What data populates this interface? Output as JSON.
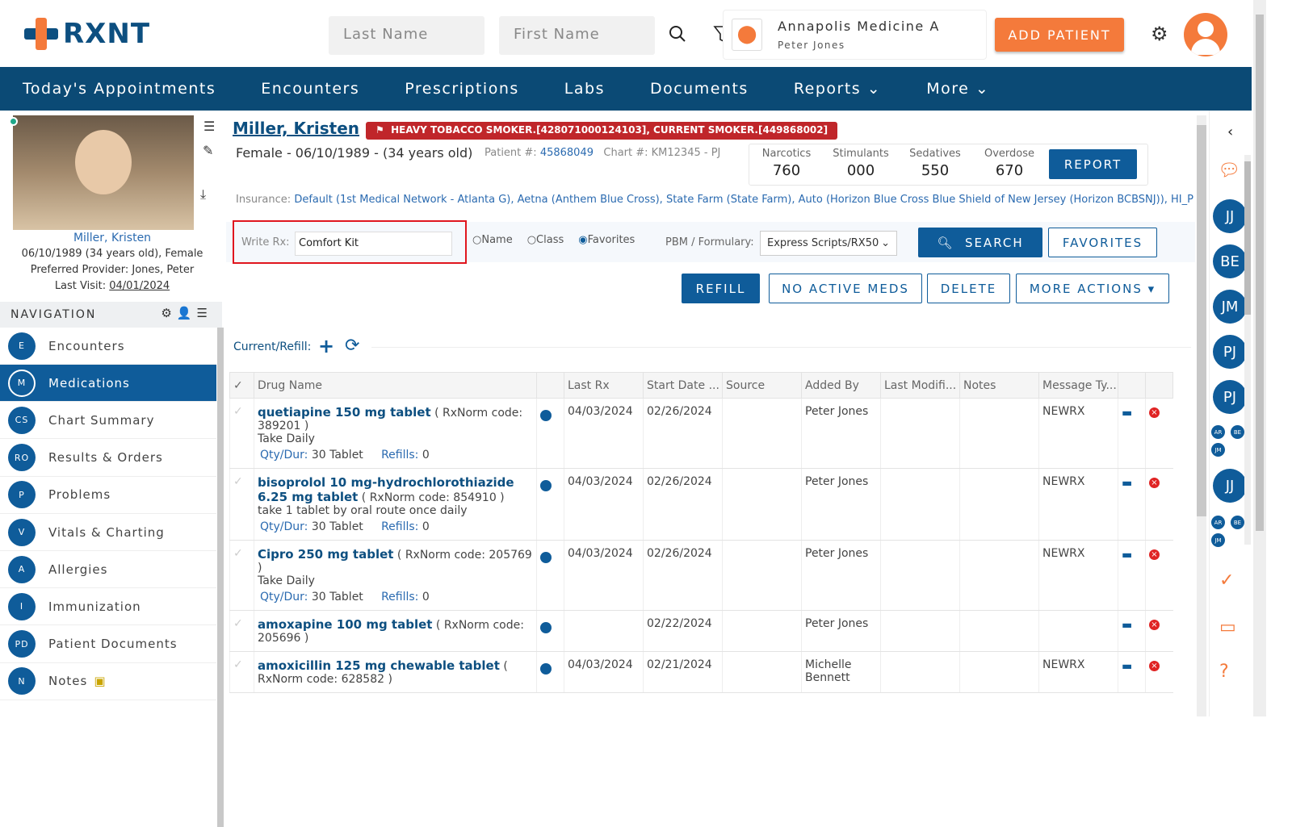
{
  "brand": "RXNT",
  "header": {
    "last_name_placeholder": "Last Name",
    "first_name_placeholder": "First Name",
    "location": "Annapolis Medicine A",
    "user": "Peter Jones",
    "add_patient": "ADD PATIENT"
  },
  "nav": [
    "Today's Appointments",
    "Encounters",
    "Prescriptions",
    "Labs",
    "Documents",
    "Reports",
    "More"
  ],
  "patient_card": {
    "name": "Miller, Kristen",
    "dob_line": "06/10/1989 (34 years old), Female",
    "provider": "Preferred Provider:  Jones, Peter",
    "last_visit_label": "Last Visit:",
    "last_visit": "04/01/2024"
  },
  "navigation": {
    "title": "NAVIGATION",
    "items": [
      {
        "code": "E",
        "label": "Encounters"
      },
      {
        "code": "M",
        "label": "Medications"
      },
      {
        "code": "CS",
        "label": "Chart Summary"
      },
      {
        "code": "RO",
        "label": "Results & Orders"
      },
      {
        "code": "P",
        "label": "Problems"
      },
      {
        "code": "V",
        "label": "Vitals & Charting"
      },
      {
        "code": "A",
        "label": "Allergies"
      },
      {
        "code": "I",
        "label": "Immunization"
      },
      {
        "code": "PD",
        "label": "Patient Documents"
      },
      {
        "code": "N",
        "label": "Notes"
      }
    ]
  },
  "patient": {
    "name": "Miller, Kristen",
    "alert": "HEAVY TOBACCO SMOKER.[428071000124103], CURRENT SMOKER.[449868002]",
    "demo": "Female - 06/10/1989 - (34 years old)",
    "patient_no_label": "Patient #:",
    "patient_no": "45868049",
    "chart": "Chart #: KM12345 - PJ",
    "insurance_label": "Insurance:",
    "insurance": "Default (1st Medical Network - Atlanta G), Aetna (Anthem Blue Cross), State Farm (State Farm), Auto (Horizon Blue Cross Blue Shield of New Jersey (Horizon BCBSNJ)), HI_P ('Nc"
  },
  "scores": [
    {
      "label": "Narcotics",
      "value": "760"
    },
    {
      "label": "Stimulants",
      "value": "000"
    },
    {
      "label": "Sedatives",
      "value": "550"
    },
    {
      "label": "Overdose",
      "value": "670"
    }
  ],
  "report": "REPORT",
  "rx": {
    "label": "Write Rx:",
    "value": "Comfort Kit",
    "opt_name": "Name",
    "opt_class": "Class",
    "opt_fav": "Favorites",
    "pbm_label": "PBM / Formulary:",
    "pbm": "Express Scripts/RX50",
    "search": "SEARCH",
    "favorites": "FAVORITES"
  },
  "actions": {
    "refill": "REFILL",
    "no_active": "NO ACTIVE MEDS",
    "delete": "DELETE",
    "more": "MORE ACTIONS"
  },
  "current_refill": "Current/Refill:",
  "columns": [
    "Drug Name",
    "Last Rx",
    "Start Date ...",
    "Source",
    "Added By",
    "Last Modifi...",
    "Notes",
    "Message Ty..."
  ],
  "meds": [
    {
      "name": "quetiapine 150 mg tablet",
      "code": "( RxNorm code: 389201 )",
      "sig": "Take Daily",
      "qty": "30 Tablet",
      "refills": "0",
      "last_rx": "04/03/2024",
      "start": "02/26/2024",
      "added_by": "Peter Jones",
      "msg": "NEWRX"
    },
    {
      "name": "bisoprolol 10 mg-hydrochlorothiazide 6.25 mg tablet",
      "code": "( RxNorm code: 854910 )",
      "sig": "take 1 tablet by oral route once daily",
      "qty": "30 Tablet",
      "refills": "0",
      "last_rx": "04/03/2024",
      "start": "02/26/2024",
      "added_by": "Peter Jones",
      "msg": "NEWRX"
    },
    {
      "name": "Cipro 250 mg tablet",
      "code": "( RxNorm code: 205769 )",
      "sig": "Take Daily",
      "qty": "30 Tablet",
      "refills": "0",
      "last_rx": "04/03/2024",
      "start": "02/26/2024",
      "added_by": "Peter Jones",
      "msg": "NEWRX"
    },
    {
      "name": "amoxapine 100 mg tablet",
      "code": "( RxNorm code: 205696 )",
      "sig": "",
      "qty": "",
      "refills": "",
      "last_rx": "",
      "start": "02/22/2024",
      "added_by": "Peter Jones",
      "msg": ""
    },
    {
      "name": "amoxicillin 125 mg chewable tablet",
      "code": "( RxNorm code: 628582 )",
      "sig": "",
      "qty": "",
      "refills": "",
      "last_rx": "04/03/2024",
      "start": "02/21/2024",
      "added_by": "Michelle Bennett",
      "msg": "NEWRX"
    }
  ],
  "qty_label": "Qty/Dur:",
  "refills_label": "Refills:",
  "rail": {
    "big": [
      "JJ",
      "BE",
      "JM",
      "PJ",
      "PJ"
    ],
    "group1": [
      "AR",
      "BE",
      "JM"
    ],
    "big2": "JJ",
    "group2": [
      "AR",
      "BE",
      "JM"
    ]
  }
}
